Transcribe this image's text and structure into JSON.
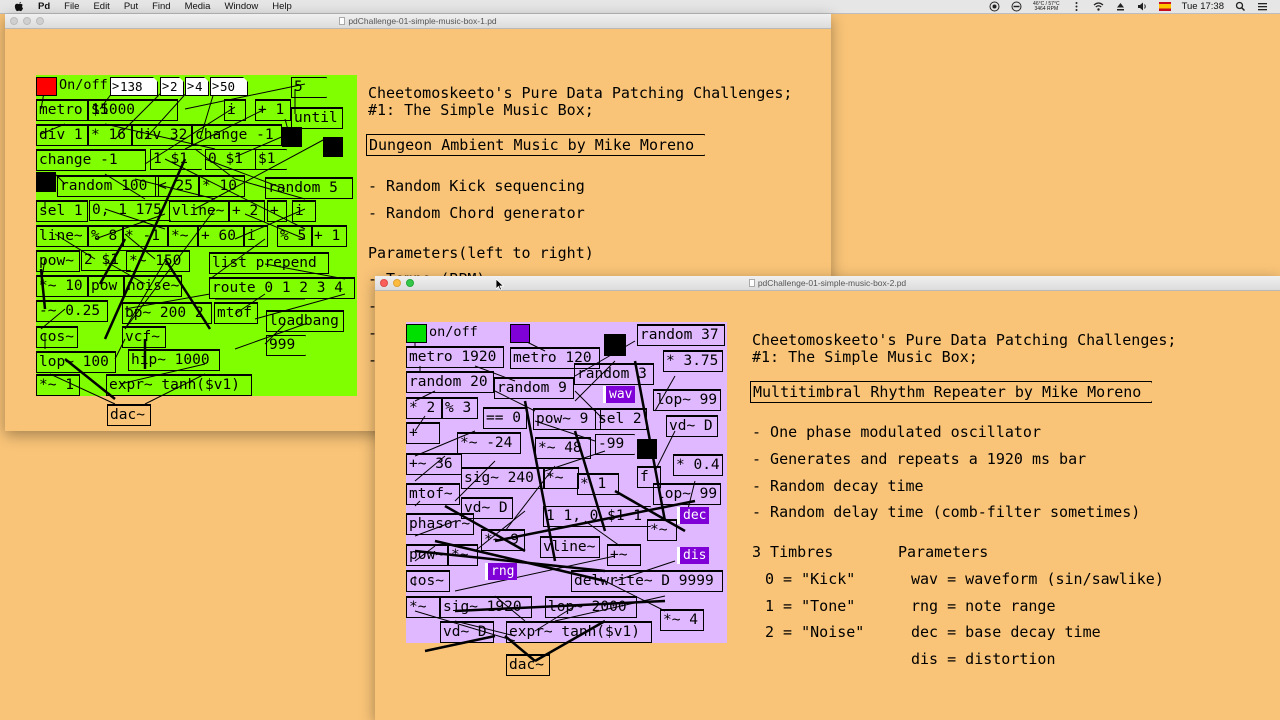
{
  "menubar": {
    "items": [
      "Pd",
      "File",
      "Edit",
      "Put",
      "Find",
      "Media",
      "Window",
      "Help"
    ],
    "temps": "46°C / 57°C",
    "rpm": "3464 RPM",
    "clock": "Tue 17:38"
  },
  "window1": {
    "title": "pdChallenge-01-simple-music-box-1.pd",
    "toggle_label": "On/off",
    "atoms": [
      "138",
      "2",
      "4",
      "50"
    ],
    "objects": [
      "metro 15000",
      "$1",
      "i",
      "+ 1",
      "until",
      "div 1",
      "* 16",
      "div 32",
      "change -1",
      "change -1",
      "1 $1",
      "0 $1",
      "$1",
      "random 100",
      "< 25",
      "* 10",
      "random 5",
      "sel 1",
      "0, 1 175",
      "vline~",
      "+ 2",
      "+",
      "i",
      "line~",
      "% 8",
      "* -1",
      "*~",
      "+ 60",
      "i",
      "% 5",
      "+ 1",
      "pow~",
      "2 $1",
      "*~ 150",
      "list prepend",
      "*~ 10",
      "pow",
      "noise~",
      "route 0 1 2 3 4",
      "-~ 0.25",
      "bp~ 200 2",
      "mtof",
      "loadbang",
      "999",
      "cos~",
      "vcf~",
      "lop~ 100",
      "hip~ 1000",
      "*~ 1",
      "expr~ tanh($v1)",
      "dac~"
    ],
    "msg_top": "5",
    "comment_heading1": "Cheetomoskeeto's Pure Data Patching Challenges;",
    "comment_heading2": "#1: The Simple Music Box;",
    "comment_title": "Dungeon Ambient Music by Mike Moreno",
    "bullets": [
      "- Random Kick sequencing",
      "- Random Chord generator"
    ],
    "params_heading": "Parameters(left to right)",
    "params": [
      "- Tempo (BPM)"
    ],
    "cut_marks": [
      "-",
      "-",
      "-"
    ]
  },
  "window2": {
    "title": "pdChallenge-01-simple-music-box-2.pd",
    "toggle_label": "on/off",
    "knobs": {
      "wav": "wav",
      "rng": "rng",
      "dec": "dec",
      "dis": "dis"
    },
    "objects": [
      "metro 1920",
      "metro 120",
      "random 37",
      "random 20",
      "random 9",
      "random 3",
      "* 3.75",
      "* 2",
      "% 3",
      "== 0",
      "pow~ 9",
      "sel 2",
      "lop~ 99",
      "+",
      "*~ -24",
      "*~ 48",
      "-99",
      "vd~ D",
      "+~ 36",
      "sig~ 240",
      "*~",
      "* 1",
      "f",
      "* 0.4",
      "mtof~",
      "vd~ D",
      "lop~ 99",
      "phasor~",
      "1 1, 0 $1 1",
      "*~",
      "*~ 9",
      "pow~",
      "*~",
      "vline~",
      "+~",
      "cos~",
      "delwrite~ D 9999",
      "*~",
      "sig~ 1920",
      "lop~ 2000",
      "*~ 4",
      "vd~ D",
      "expr~ tanh($v1)",
      "dac~"
    ],
    "comment_heading1": "Cheetomoskeeto's Pure Data Patching Challenges;",
    "comment_heading2": "#1: The Simple Music Box;",
    "comment_title": "Multitimbral Rhythm Repeater by Mike Moreno",
    "bullets": [
      "- One phase modulated oscillator",
      "- Generates and repeats a 1920 ms bar",
      "- Random decay time",
      "- Random delay time (comb-filter sometimes)"
    ],
    "timbres_heading": "3 Timbres",
    "timbres": [
      "0 = \"Kick\"",
      "1 = \"Tone\"",
      "2 = \"Noise\""
    ],
    "params_heading": "Parameters",
    "params": [
      "wav = waveform (sin/sawlike)",
      "rng = note range",
      "dec = base decay time",
      "dis = distortion"
    ]
  },
  "colors": {
    "desktop": "#f9c478",
    "patch1_bg": "#80ff00",
    "patch2_bg": "#e0b8ff",
    "toggle_on_red": "#ff0000",
    "toggle_on_green": "#00e000",
    "knob": "#8000d8"
  }
}
